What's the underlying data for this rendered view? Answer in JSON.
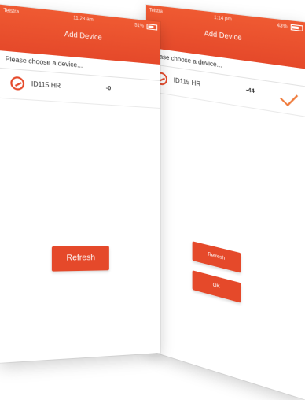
{
  "back_screen": {
    "status": {
      "carrier": "Telstra",
      "time": "1:14 pm",
      "battery": "43%"
    },
    "title": "Add Device",
    "prompt": "Please choose a device...",
    "device": {
      "name": "ID115 HR",
      "rssi": "-44"
    },
    "buttons": {
      "refresh": "Refresh",
      "ok": "OK"
    }
  },
  "front_screen": {
    "status": {
      "carrier": "Telstra",
      "time": "11:23 am",
      "battery": "51%"
    },
    "title": "Add Device",
    "prompt": "Please choose a device...",
    "device": {
      "name": "ID115 HR",
      "rssi": "-0"
    },
    "buttons": {
      "refresh": "Refresh"
    }
  },
  "colors": {
    "accent": "#e5492a",
    "check": "#ef7a3a"
  },
  "icons": {
    "device": "device-link-icon",
    "selected": "checkmark-icon",
    "battery": "battery-icon"
  }
}
